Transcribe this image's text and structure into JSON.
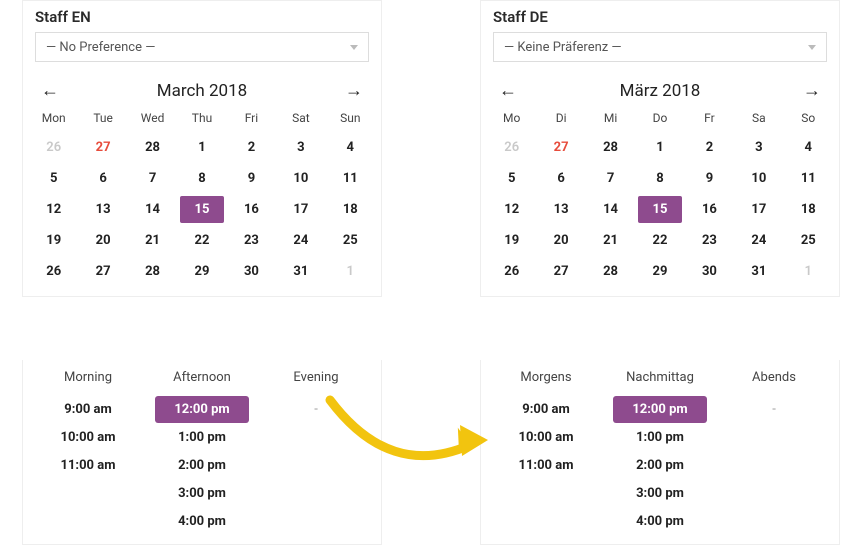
{
  "en": {
    "title": "Staff EN",
    "pref": "— No Preference —",
    "month": "March 2018",
    "dows": [
      "Mon",
      "Tue",
      "Wed",
      "Thu",
      "Fri",
      "Sat",
      "Sun"
    ],
    "days": [
      {
        "n": "26",
        "cls": "out"
      },
      {
        "n": "27",
        "cls": "hol"
      },
      {
        "n": "28",
        "cls": ""
      },
      {
        "n": "1",
        "cls": ""
      },
      {
        "n": "2",
        "cls": ""
      },
      {
        "n": "3",
        "cls": ""
      },
      {
        "n": "4",
        "cls": ""
      },
      {
        "n": "5",
        "cls": ""
      },
      {
        "n": "6",
        "cls": ""
      },
      {
        "n": "7",
        "cls": ""
      },
      {
        "n": "8",
        "cls": ""
      },
      {
        "n": "9",
        "cls": ""
      },
      {
        "n": "10",
        "cls": ""
      },
      {
        "n": "11",
        "cls": ""
      },
      {
        "n": "12",
        "cls": ""
      },
      {
        "n": "13",
        "cls": ""
      },
      {
        "n": "14",
        "cls": ""
      },
      {
        "n": "15",
        "cls": "sel"
      },
      {
        "n": "16",
        "cls": ""
      },
      {
        "n": "17",
        "cls": ""
      },
      {
        "n": "18",
        "cls": ""
      },
      {
        "n": "19",
        "cls": ""
      },
      {
        "n": "20",
        "cls": ""
      },
      {
        "n": "21",
        "cls": ""
      },
      {
        "n": "22",
        "cls": ""
      },
      {
        "n": "23",
        "cls": ""
      },
      {
        "n": "24",
        "cls": ""
      },
      {
        "n": "25",
        "cls": ""
      },
      {
        "n": "26",
        "cls": ""
      },
      {
        "n": "27",
        "cls": ""
      },
      {
        "n": "28",
        "cls": ""
      },
      {
        "n": "29",
        "cls": ""
      },
      {
        "n": "30",
        "cls": ""
      },
      {
        "n": "31",
        "cls": ""
      },
      {
        "n": "1",
        "cls": "out"
      }
    ],
    "slot_headers": [
      "Morning",
      "Afternoon",
      "Evening"
    ],
    "slots_morning": [
      "9:00 am",
      "10:00 am",
      "11:00 am"
    ],
    "slots_afternoon": [
      {
        "t": "12:00 pm",
        "sel": true
      },
      {
        "t": "1:00 pm"
      },
      {
        "t": "2:00 pm"
      },
      {
        "t": "3:00 pm"
      },
      {
        "t": "4:00 pm"
      }
    ],
    "slots_evening_none": "-"
  },
  "de": {
    "title": "Staff DE",
    "pref": "— Keine Präferenz —",
    "month": "März 2018",
    "dows": [
      "Mo",
      "Di",
      "Mi",
      "Do",
      "Fr",
      "Sa",
      "So"
    ],
    "days": [
      {
        "n": "26",
        "cls": "out"
      },
      {
        "n": "27",
        "cls": "hol"
      },
      {
        "n": "28",
        "cls": ""
      },
      {
        "n": "1",
        "cls": ""
      },
      {
        "n": "2",
        "cls": ""
      },
      {
        "n": "3",
        "cls": ""
      },
      {
        "n": "4",
        "cls": ""
      },
      {
        "n": "5",
        "cls": ""
      },
      {
        "n": "6",
        "cls": ""
      },
      {
        "n": "7",
        "cls": ""
      },
      {
        "n": "8",
        "cls": ""
      },
      {
        "n": "9",
        "cls": ""
      },
      {
        "n": "10",
        "cls": ""
      },
      {
        "n": "11",
        "cls": ""
      },
      {
        "n": "12",
        "cls": ""
      },
      {
        "n": "13",
        "cls": ""
      },
      {
        "n": "14",
        "cls": ""
      },
      {
        "n": "15",
        "cls": "sel"
      },
      {
        "n": "16",
        "cls": ""
      },
      {
        "n": "17",
        "cls": ""
      },
      {
        "n": "18",
        "cls": ""
      },
      {
        "n": "19",
        "cls": ""
      },
      {
        "n": "20",
        "cls": ""
      },
      {
        "n": "21",
        "cls": ""
      },
      {
        "n": "22",
        "cls": ""
      },
      {
        "n": "23",
        "cls": ""
      },
      {
        "n": "24",
        "cls": ""
      },
      {
        "n": "25",
        "cls": ""
      },
      {
        "n": "26",
        "cls": ""
      },
      {
        "n": "27",
        "cls": ""
      },
      {
        "n": "28",
        "cls": ""
      },
      {
        "n": "29",
        "cls": ""
      },
      {
        "n": "30",
        "cls": ""
      },
      {
        "n": "31",
        "cls": ""
      },
      {
        "n": "1",
        "cls": "out"
      }
    ],
    "slot_headers": [
      "Morgens",
      "Nachmittag",
      "Abends"
    ],
    "slots_morning": [
      "9:00 am",
      "10:00 am",
      "11:00 am"
    ],
    "slots_afternoon": [
      {
        "t": "12:00 pm",
        "sel": true
      },
      {
        "t": "1:00 pm"
      },
      {
        "t": "2:00 pm"
      },
      {
        "t": "3:00 pm"
      },
      {
        "t": "4:00 pm"
      }
    ],
    "slots_evening_none": "-"
  }
}
